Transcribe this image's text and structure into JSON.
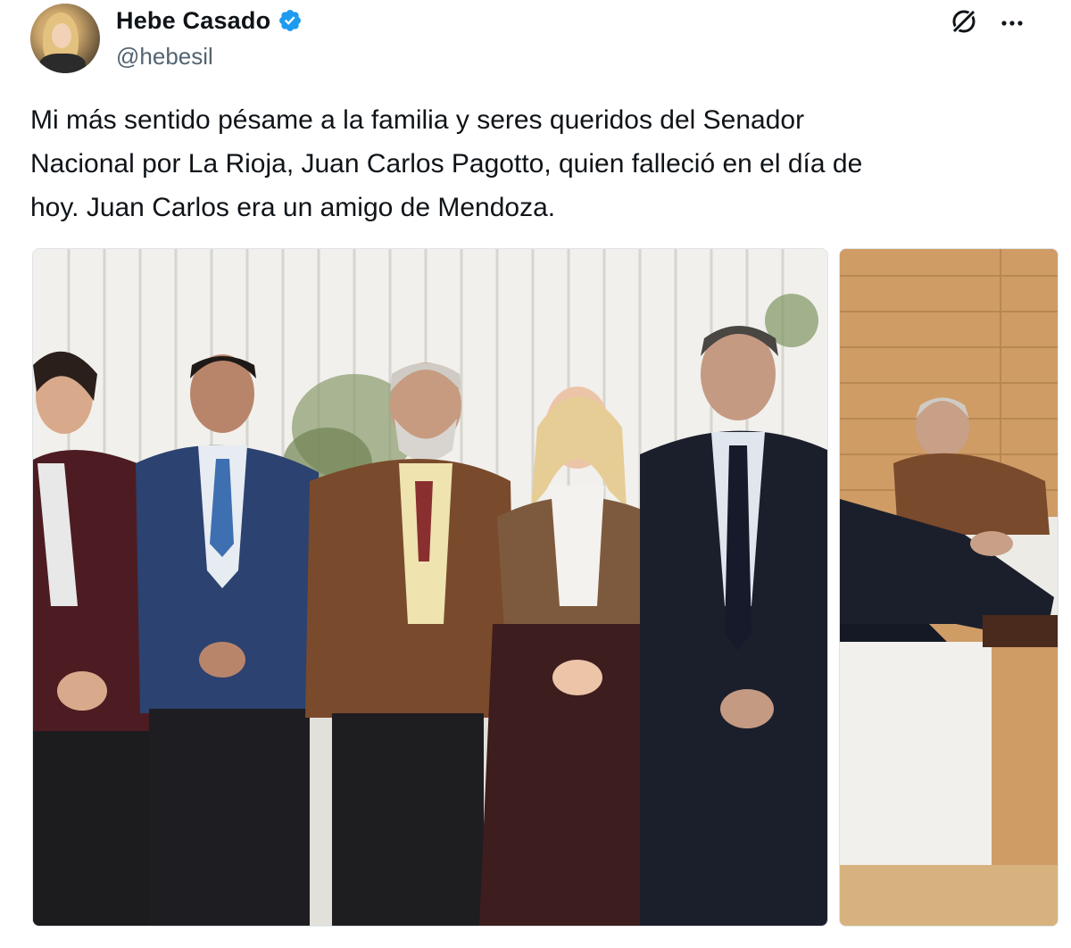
{
  "author": {
    "display_name": "Hebe Casado",
    "handle": "@hebesil",
    "verified": true
  },
  "icons": {
    "avatar": "avatar",
    "verified": "verified-badge-icon",
    "grok": "grok-icon",
    "more": "more-options-icon"
  },
  "tweet": {
    "text": "Mi más sentido pésame a la familia y seres queridos del Senador\nNacional por La Rioja, Juan Carlos Pagotto, quien falleció en el día de\nhoy. Juan Carlos era un amigo de Mendoza."
  },
  "media": [
    {
      "kind": "photo",
      "subject": "group-photo"
    },
    {
      "kind": "photo",
      "subject": "sofa-photo"
    }
  ],
  "colors": {
    "text": "#0f1419",
    "secondary": "#536471",
    "verified": "#1d9bf0"
  }
}
